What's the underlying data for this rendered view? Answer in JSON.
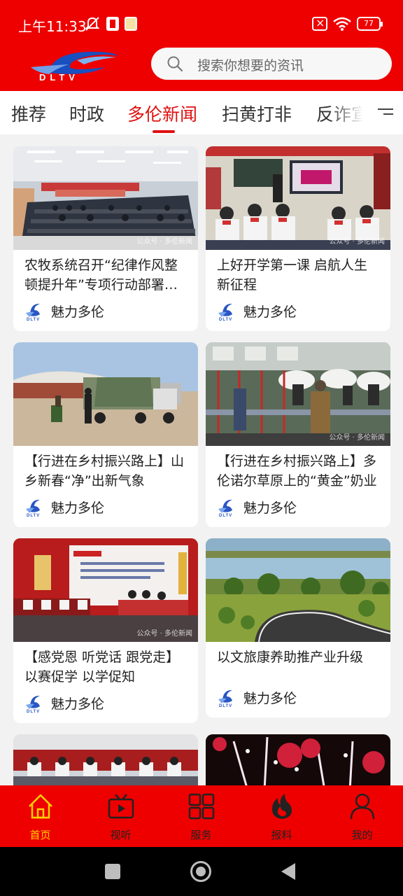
{
  "status_bar": {
    "time": "上午11:33",
    "battery": "77"
  },
  "header": {
    "search_placeholder": "搜索你想要的资讯"
  },
  "tabs": [
    {
      "label": "推荐"
    },
    {
      "label": "时政"
    },
    {
      "label": "多伦新闻",
      "active": true
    },
    {
      "label": "扫黄打非"
    },
    {
      "label": "反诈宣"
    }
  ],
  "feed": {
    "source_name": "魅力多伦",
    "watermark": "公众号 · 多伦新闻",
    "cards": [
      {
        "title": "农牧系统召开“纪律作风整顿提升年”专项行动部署会议"
      },
      {
        "title": "上好开学第一课  启航人生新征程"
      },
      {
        "title": "【行进在乡村振兴路上】山乡新春“净”出新气象"
      },
      {
        "title": "【行进在乡村振兴路上】多伦诺尔草原上的“黄金”奶业"
      },
      {
        "title": "【感党恩  听党话  跟党走】以赛促学  以学促知"
      },
      {
        "title": "以文旅康养助推产业升级"
      }
    ]
  },
  "bottom_nav": [
    {
      "label": "首页",
      "icon": "home-icon",
      "active": true
    },
    {
      "label": "视听",
      "icon": "video-icon"
    },
    {
      "label": "服务",
      "icon": "grid-icon"
    },
    {
      "label": "报料",
      "icon": "fire-icon"
    },
    {
      "label": "我的",
      "icon": "user-icon"
    }
  ],
  "colors": {
    "brand_red": "#ee0000",
    "active_tab": "#e01010",
    "nav_active": "#ffd000"
  }
}
